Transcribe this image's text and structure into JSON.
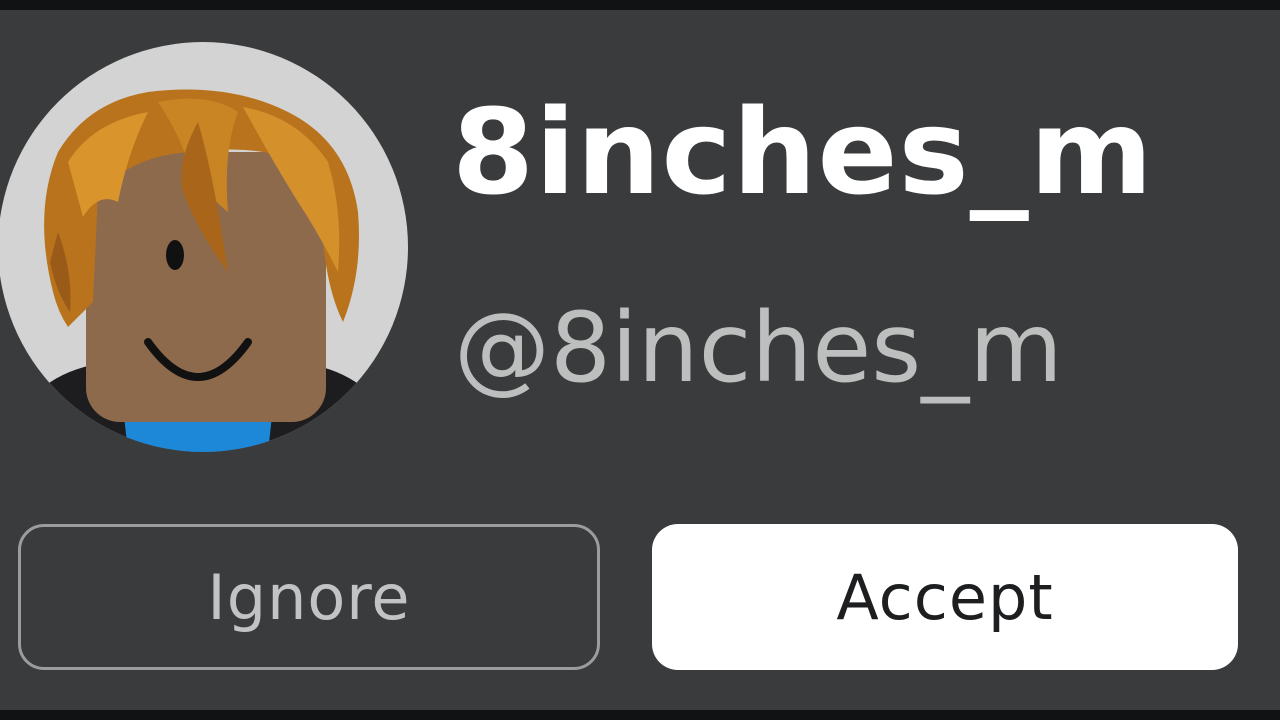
{
  "profile": {
    "display_name": "8inches_m",
    "username": "@8inches_m",
    "avatar_icon": "roblox-avatar-icon"
  },
  "actions": {
    "ignore_label": "Ignore",
    "accept_label": "Accept"
  },
  "colors": {
    "background": "#393b3d",
    "display_name": "#ffffff",
    "username": "#bdbebe",
    "accept_bg": "#ffffff",
    "ignore_border": "#9a9c9e"
  }
}
